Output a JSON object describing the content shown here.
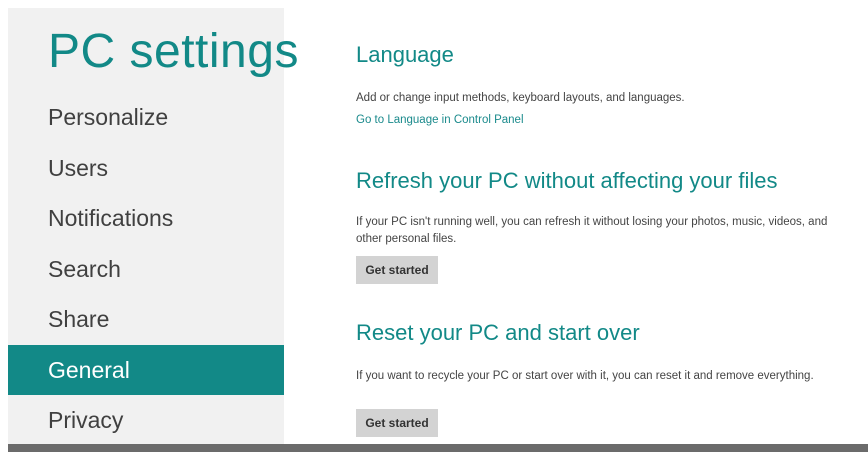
{
  "app": {
    "title": "PC settings"
  },
  "sidebar": {
    "items": [
      {
        "label": "Personalize"
      },
      {
        "label": "Users"
      },
      {
        "label": "Notifications"
      },
      {
        "label": "Search"
      },
      {
        "label": "Share"
      },
      {
        "label": "General",
        "selected": true
      },
      {
        "label": "Privacy"
      }
    ]
  },
  "sections": {
    "language": {
      "title": "Language",
      "description": "Add or change input methods, keyboard layouts, and languages.",
      "link": "Go to Language in Control Panel"
    },
    "refresh": {
      "title": "Refresh your PC without affecting your files",
      "description": "If your PC isn't running well, you can refresh it without losing your photos, music, videos, and other personal files.",
      "button": "Get started"
    },
    "reset": {
      "title": "Reset your PC and start over",
      "description": "If you want to recycle your PC or start over with it, you can reset it and remove everything.",
      "button": "Get started"
    }
  },
  "colors": {
    "accent": "#128987",
    "sidebar_background": "#f1f1f1",
    "button_background": "#d3d3d3"
  }
}
